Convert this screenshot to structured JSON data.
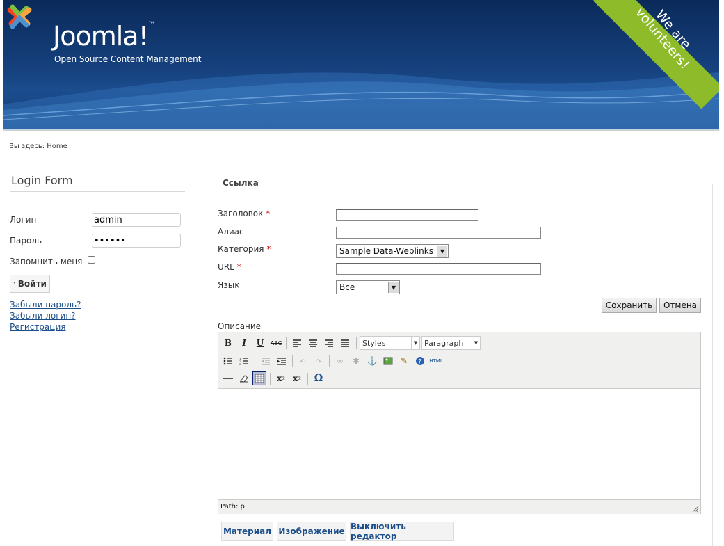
{
  "header": {
    "logo_name": "Joomla!",
    "tagline": "Open Source Content Management",
    "ribbon": [
      "We are",
      "volunteers!"
    ]
  },
  "breadcrumb": "Вы здесь: Home",
  "login": {
    "title": "Login Form",
    "username_label": "Логин",
    "username_value": "admin",
    "password_label": "Пароль",
    "password_value": "••••••",
    "remember_label": "Запомнить меня",
    "submit_label": "Войти",
    "links": [
      "Забыли пароль?",
      "Забыли логин?",
      "Регистрация"
    ]
  },
  "form": {
    "legend": "Ссылка",
    "fields": {
      "title_label": "Заголовок",
      "alias_label": "Алиас",
      "category_label": "Категория",
      "category_value": "Sample Data-Weblinks",
      "url_label": "URL",
      "language_label": "Язык",
      "language_value": "Все",
      "required_mark": "*"
    },
    "save_label": "Сохранить",
    "cancel_label": "Отмена",
    "description_label": "Описание"
  },
  "editor": {
    "styles_value": "Styles",
    "format_value": "Paragraph",
    "path": "Path: p",
    "buttons_row1": [
      "bold-icon",
      "italic-icon",
      "underline-icon",
      "strikethrough-icon",
      "align-left-icon",
      "align-center-icon",
      "align-right-icon",
      "align-justify-icon"
    ],
    "buttons_row2": [
      "bullet-list-icon",
      "numbered-list-icon",
      "outdent-icon",
      "indent-icon",
      "undo-icon",
      "redo-icon",
      "link-icon",
      "unlink-icon",
      "anchor-icon",
      "image-icon",
      "cleanup-icon",
      "help-icon",
      "html-icon"
    ],
    "buttons_row3": [
      "horizontal-rule-icon",
      "remove-format-icon",
      "visual-aid-icon",
      "subscript-icon",
      "superscript-icon",
      "special-char-icon"
    ]
  },
  "bottom_buttons": [
    "Материал",
    "Изображение",
    "Выключить редактор"
  ]
}
